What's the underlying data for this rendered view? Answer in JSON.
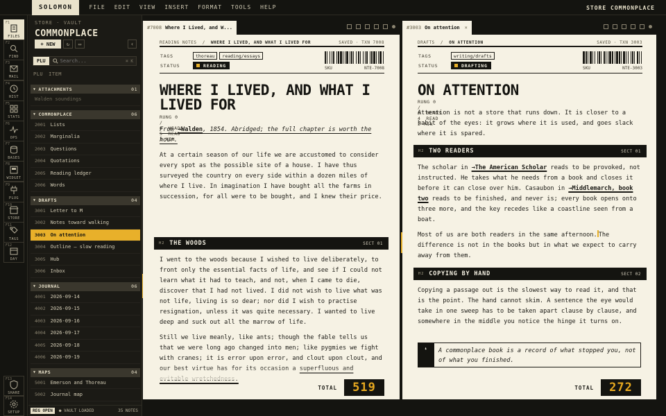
{
  "menubar": {
    "brand": "SOLOMON",
    "items": [
      "FILE",
      "EDIT",
      "VIEW",
      "INSERT",
      "FORMAT",
      "TOOLS",
      "HELP"
    ],
    "right": "STORE COMMONPLACE"
  },
  "rail": {
    "items": [
      {
        "key": "F1",
        "label": "FILES",
        "icon": "files-icon"
      },
      {
        "key": "F2",
        "label": "FIND",
        "icon": "search-icon"
      },
      {
        "key": "F3",
        "label": "MAIL",
        "icon": "mail-icon"
      },
      {
        "key": "F4",
        "label": "HIST",
        "icon": "history-icon"
      },
      {
        "key": "F5",
        "label": "STATS",
        "icon": "grid-icon"
      },
      {
        "key": "F6",
        "label": "OPS",
        "icon": "pulse-icon"
      },
      {
        "key": "F7",
        "label": "BASES",
        "icon": "database-icon"
      },
      {
        "key": "F8",
        "label": "WIDGET",
        "icon": "widget-icon"
      },
      {
        "key": "F9",
        "label": "PLUG",
        "icon": "plug-icon"
      },
      {
        "key": "F10",
        "label": "STORE",
        "icon": "store-icon"
      },
      {
        "key": "F11",
        "label": "TAGS",
        "icon": "tag-icon"
      },
      {
        "key": "F12",
        "label": "DAY",
        "icon": "calendar-icon"
      }
    ],
    "bottom": [
      {
        "key": "F13",
        "label": "SHARE",
        "icon": "shield-icon"
      },
      {
        "key": "F14",
        "label": "SETUP",
        "icon": "gear-icon"
      }
    ]
  },
  "sidebar": {
    "crumb": "STORE · VAULT",
    "title": "COMMONPLACE",
    "new_label": "+ NEW",
    "search": {
      "mode": "PLU",
      "placeholder": "Search...",
      "shortcut": "⌘ K"
    },
    "cols": [
      "PLU",
      "ITEM"
    ],
    "groups": [
      {
        "name": "ATTACHMENTS",
        "count": "01",
        "items": [
          {
            "id": "",
            "label": "Walden soundings",
            "dim": true
          }
        ]
      },
      {
        "name": "COMMONPLACE",
        "count": "06",
        "items": [
          {
            "id": "2001",
            "label": "Lists"
          },
          {
            "id": "2002",
            "label": "Marginalia"
          },
          {
            "id": "2003",
            "label": "Questions"
          },
          {
            "id": "2004",
            "label": "Quotations"
          },
          {
            "id": "2005",
            "label": "Reading ledger"
          },
          {
            "id": "2006",
            "label": "Words"
          }
        ]
      },
      {
        "name": "DRAFTS",
        "count": "04",
        "items": [
          {
            "id": "3001",
            "label": "Letter to M"
          },
          {
            "id": "3002",
            "label": "Notes toward walking"
          },
          {
            "id": "3003",
            "label": "On attention",
            "active": true
          },
          {
            "id": "3004",
            "label": "Outline — slow reading"
          },
          {
            "id": "3005",
            "label": "Hub"
          },
          {
            "id": "3006",
            "label": "Inbox"
          }
        ]
      },
      {
        "name": "JOURNAL",
        "count": "06",
        "items": [
          {
            "id": "4001",
            "label": "2026-09-14"
          },
          {
            "id": "4002",
            "label": "2026-09-15"
          },
          {
            "id": "4003",
            "label": "2026-09-16"
          },
          {
            "id": "4004",
            "label": "2026-09-17"
          },
          {
            "id": "4005",
            "label": "2026-09-18"
          },
          {
            "id": "4006",
            "label": "2026-09-19"
          }
        ]
      },
      {
        "name": "MAPS",
        "count": "04",
        "items": [
          {
            "id": "5001",
            "label": "Emerson and Thoreau"
          },
          {
            "id": "5002",
            "label": "Journal map"
          }
        ]
      }
    ],
    "status": {
      "reg": "REG OPEN",
      "vault": "● VAULT LOADED",
      "notes": "35 NOTES"
    }
  },
  "pane_a": {
    "tab_id": "#7008",
    "tab_title": "Where I Lived, and W...",
    "crumb": "READING NOTES",
    "crumb_current": "WHERE I LIVED, AND WHAT I LIVED FOR",
    "saved": "SAVED · TXN 7008",
    "tags_label": "TAGS",
    "tags": [
      "thoreau",
      "reading/essays"
    ],
    "status_label": "STATUS",
    "status": "READING",
    "sku_label": "SKU",
    "sku": "NTE-7008",
    "title": "WHERE I LIVED, AND WHAT I LIVED FOR",
    "stats": [
      "RUNG 0 / 0",
      "HEADS 5",
      "READ 3 MIN"
    ],
    "quote_pre": "From ",
    "quote_link": "→Walden",
    "quote_post": ", 1854. Abridged; the full chapter is worth the hour.",
    "p1": "At a certain season of our life we are accustomed to consider every spot as the possible site of a house. I have thus surveyed the country on every side within a dozen miles of where I live. In imagination I have bought all the farms in succession, for all were to be bought, and I knew their price.",
    "h2_marker": "H2",
    "h2": "THE WOODS",
    "h2_sect": "SECT 01",
    "p2": "I went to the woods because I wished to live deliberately, to front only the essential facts of life, and see if I could not learn what it had to teach, and not, when I came to die, discover that I had not lived. I did not wish to live what was not life, living is so dear; nor did I wish to practise resignation, unless it was quite necessary. I wanted to live deep and suck out all the marrow of life.",
    "p3_pre": "Still we live meanly, like ants; though the fable tells us that we were long ago changed into men; like pygmies we fight with cranes; it is error upon error, and clout upon clout, and our best virtue has for its occasion a ",
    "p3_ul": "superfluous and evitable wretchedness.",
    "total_label": "TOTAL",
    "total": "519"
  },
  "pane_b": {
    "tab_id": "#3003",
    "tab_title": "On attention",
    "crumb": "DRAFTS",
    "crumb_current": "ON ATTENTION",
    "saved": "SAVED · TXN 3003",
    "tags_label": "TAGS",
    "tags": [
      "writing/drafts"
    ],
    "status_label": "STATUS",
    "status": "DRAFTING",
    "sku_label": "SKU",
    "sku": "NTE-3003",
    "title": "ON ATTENTION",
    "stats": [
      "RUNG 0 / 0",
      "HEADS 4",
      "READ 2 MIN"
    ],
    "p1": "Attention is not a store that runs down. It is closer to a habit of the eyes: it grows where it is used, and goes slack where it is spared.",
    "h2a_marker": "H2",
    "h2a": "TWO READERS",
    "h2a_sect": "SECT 01",
    "p2_a": "The scholar in ",
    "p2_link1": "→The American Scholar",
    "p2_b": " reads to be provoked, not instructed. He takes what he needs from a book and closes it before it can close over him. Casaubon in ",
    "p2_link2": "→Middlemarch, book two",
    "p2_c": " reads to be finished, and never is; every book opens onto three more, and the key recedes like a coastline seen from a boat.",
    "p3_a": "Most of us are both readers in the same afternoon.",
    "p3_b": "The difference is not in the books but in what we expect to carry away from them.",
    "h2b_marker": "H2",
    "h2b": "COPYING BY HAND",
    "h2b_sect": "SECT 02",
    "p4": "Copying a passage out is the slowest way to read it, and that is the point. The hand cannot skim. A sentence the eye would take in one sweep has to be taken apart clause by clause, and somewhere in the middle you notice the hinge it turns on.",
    "callout_mark": "❛",
    "callout": "A commonplace book is a record of what stopped you, not of what you finished.",
    "total_label": "TOTAL",
    "total": "272"
  },
  "colors": {
    "accent": "#e8b02a",
    "ink": "#141410",
    "paper": "#f6f2e4"
  }
}
